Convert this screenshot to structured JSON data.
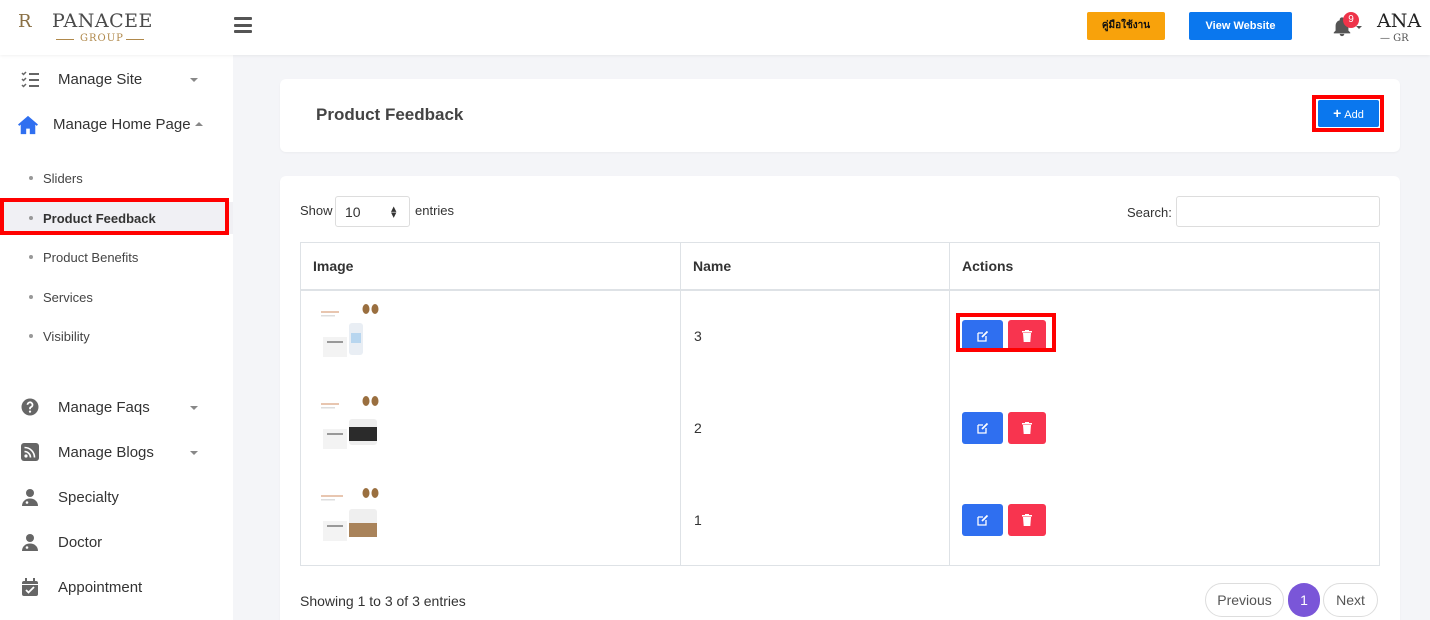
{
  "header": {
    "logo_crest": "R",
    "logo_brand": "PANACEE",
    "logo_sub": "GROUP",
    "manual_button": "คู่มือใช้งาน",
    "view_website_button": "View Website",
    "notification_count": "9",
    "avatar_text": "ANA",
    "avatar_sub": "— GR",
    "accent_orange": "#f8a20b",
    "accent_blue": "#0a77ee"
  },
  "sidebar": {
    "items": [
      {
        "label": "Manage Site",
        "icon": "checklist-icon"
      },
      {
        "label": "Manage Home Page",
        "icon": "home-icon"
      },
      {
        "label": "Manage Faqs",
        "icon": "question-icon"
      },
      {
        "label": "Manage Blogs",
        "icon": "rss-icon"
      },
      {
        "label": "Specialty",
        "icon": "user-doctor-icon"
      },
      {
        "label": "Doctor",
        "icon": "user-doctor-icon"
      },
      {
        "label": "Appointment",
        "icon": "calendar-check-icon"
      }
    ],
    "subitems": [
      {
        "label": "Sliders"
      },
      {
        "label": "Product Feedback"
      },
      {
        "label": "Product Benefits"
      },
      {
        "label": "Services"
      },
      {
        "label": "Visibility"
      }
    ]
  },
  "page": {
    "title": "Product Feedback",
    "add_button": "Add"
  },
  "table_controls": {
    "show_label": "Show",
    "entries_value": "10",
    "entries_label": "entries",
    "search_label": "Search:"
  },
  "table": {
    "columns": [
      "Image",
      "Name",
      "Actions"
    ],
    "rows": [
      {
        "name": "3"
      },
      {
        "name": "2"
      },
      {
        "name": "1"
      }
    ]
  },
  "pagination": {
    "summary": "Showing 1 to 3 of 3 entries",
    "previous": "Previous",
    "current": "1",
    "next": "Next"
  }
}
